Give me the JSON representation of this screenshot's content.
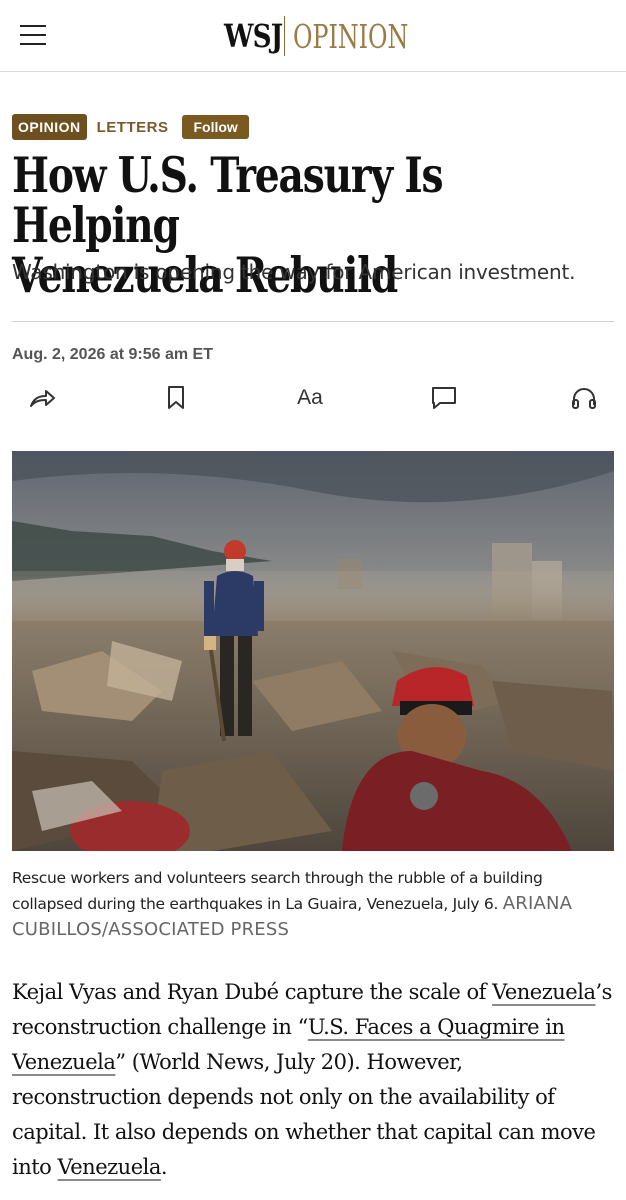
{
  "header": {
    "masthead_wsj": "WSJ",
    "masthead_section": "OPINION"
  },
  "article": {
    "section_tag": "OPINION",
    "category": "LETTERS",
    "follow_label": "Follow",
    "headline_line1": "How U.S. Treasury Is Helping",
    "headline_line2": "Venezuela Rebuild",
    "dek": "Washington is opening the way for American investment.",
    "dateline": "Aug. 2, 2026 at 9:56 am ET"
  },
  "actions": [
    {
      "icon": "share-icon"
    },
    {
      "icon": "bookmark-icon"
    },
    {
      "icon": "text-size-icon",
      "label": "Aa"
    },
    {
      "icon": "comment-icon"
    },
    {
      "icon": "listen-headphones-icon"
    }
  ],
  "photo": {
    "caption_line1": "Rescue workers and volunteers search through the rubble of a building",
    "caption_line2": "collapsed during the earthquakes in La Guaira, Venezuela, July 6.",
    "credit_part1": "ARIANA",
    "credit_part2": "CUBILLOS/ASSOCIATED PRESS"
  },
  "body": {
    "p1_a": "Kejal Vyas and Ryan Dubé capture the scale of ",
    "p1_link1": "Venezuela",
    "p1_b": "’s reconstruction challenge in “",
    "p1_link2": "U.S. Faces a Quagmire in Venezuela",
    "p1_c": "” (World News, July 20). However, reconstruction depends not only on the availability of capital. It also depends on whether that capital can move into ",
    "p1_link3": "Venezuela",
    "p1_d": "."
  },
  "colors": {
    "accent_brown": "#6e4f1f",
    "opinion_gold": "#9a7a45"
  }
}
